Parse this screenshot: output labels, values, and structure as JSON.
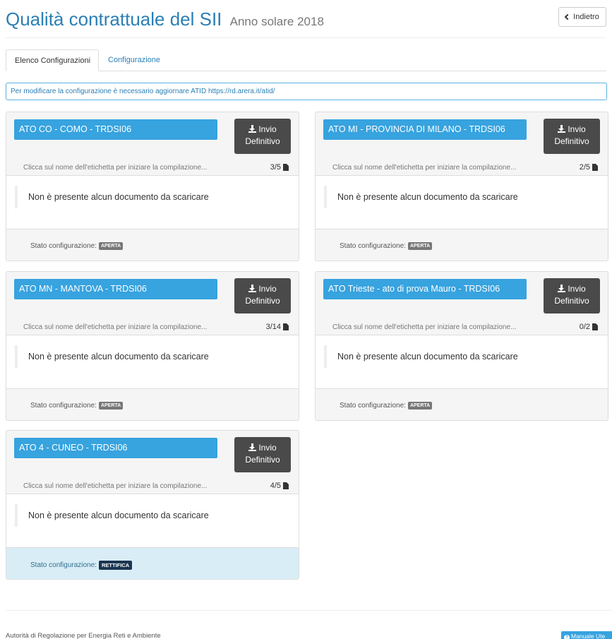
{
  "header": {
    "title": "Qualità contrattuale del SII",
    "subtitle": "Anno solare 2018",
    "back_label": "Indietro"
  },
  "tabs": [
    {
      "label": "Elenco Configurazioni",
      "active": true
    },
    {
      "label": "Configurazione",
      "active": false
    }
  ],
  "notice": "Per modificare la configurazione è necessario aggiornare ATID https://rd.arera.it/atid/",
  "cards": [
    {
      "name": "ATO CO - COMO - TRDSI06",
      "send_label_1": "Invio",
      "send_label_2": "Definitivo",
      "hint": "Clicca sul nome dell'etichetta per iniziare la compilazione...",
      "count": "3/5",
      "empty_msg": "Non è presente alcun documento da scaricare",
      "status_label": "Stato configurazione:",
      "status": "APERTA"
    },
    {
      "name": "ATO MI - PROVINCIA DI MILANO - TRDSI06",
      "send_label_1": "Invio",
      "send_label_2": "Definitivo",
      "hint": "Clicca sul nome dell'etichetta per iniziare la compilazione...",
      "count": "2/5",
      "empty_msg": "Non è presente alcun documento da scaricare",
      "status_label": "Stato configurazione:",
      "status": "APERTA"
    },
    {
      "name": "ATO MN - MANTOVA - TRDSI06",
      "send_label_1": "Invio",
      "send_label_2": "Definitivo",
      "hint": "Clicca sul nome dell'etichetta per iniziare la compilazione...",
      "count": "3/14",
      "empty_msg": "Non è presente alcun documento da scaricare",
      "status_label": "Stato configurazione:",
      "status": "APERTA"
    },
    {
      "name": "ATO Trieste - ato di prova Mauro - TRDSI06",
      "send_label_1": "Invio",
      "send_label_2": "Definitivo",
      "hint": "Clicca sul nome dell'etichetta per iniziare la compilazione...",
      "count": "0/2",
      "empty_msg": "Non è presente alcun documento da scaricare",
      "status_label": "Stato configurazione:",
      "status": "APERTA"
    },
    {
      "name": "ATO 4 - CUNEO - TRDSI06",
      "send_label_1": "Invio",
      "send_label_2": "Definitivo",
      "hint": "Clicca sul nome dell'etichetta per iniziare la compilazione...",
      "count": "4/5",
      "empty_msg": "Non è presente alcun documento da scaricare",
      "status_label": "Stato configurazione:",
      "status": "RETTIFICA"
    }
  ],
  "footer": {
    "text": "Autorità di Regolazione per Energia Reti e Ambiente",
    "manual_label": "Manuale Ute"
  },
  "colors": {
    "accent": "#37a3df",
    "title": "#2a7fb5",
    "button_dark": "#4a4a4a",
    "badge_default": "#777777",
    "badge_dark": "#1a3550",
    "info_bg": "#d9edf7"
  }
}
